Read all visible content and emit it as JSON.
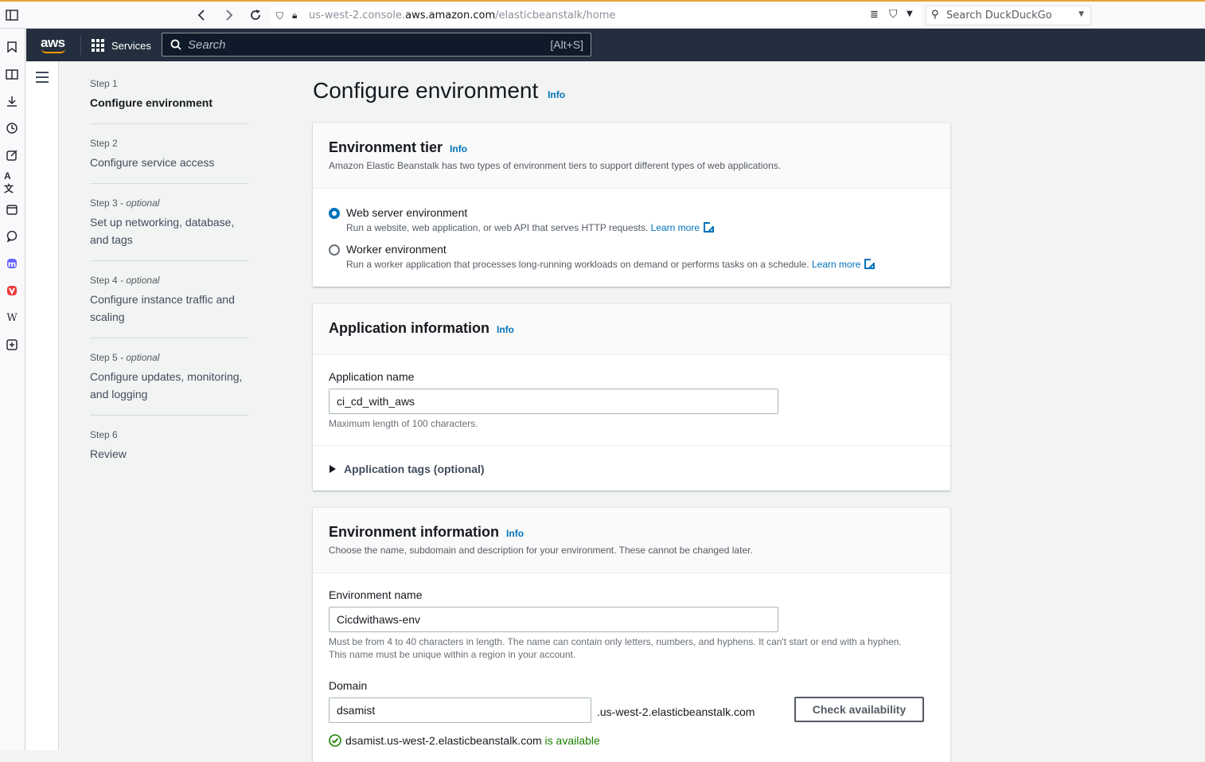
{
  "browser": {
    "url_prefix": "us-west-2.console.",
    "url_host": "aws.amazon.com",
    "url_path": "/elasticbeanstalk/home",
    "search_placeholder": "Search DuckDuckGo"
  },
  "aws_header": {
    "logo": "aws",
    "services_label": "Services",
    "search_placeholder": "Search",
    "search_shortcut": "[Alt+S]"
  },
  "steps": [
    {
      "num": "Step 1",
      "optional": "",
      "title": "Configure environment"
    },
    {
      "num": "Step 2",
      "optional": "",
      "title": "Configure service access"
    },
    {
      "num": "Step 3",
      "optional": " - optional",
      "title": "Set up networking, database, and tags"
    },
    {
      "num": "Step 4",
      "optional": " - optional",
      "title": "Configure instance traffic and scaling"
    },
    {
      "num": "Step 5",
      "optional": " - optional",
      "title": "Configure updates, monitoring, and logging"
    },
    {
      "num": "Step 6",
      "optional": "",
      "title": "Review"
    }
  ],
  "page": {
    "title": "Configure environment",
    "info": "Info"
  },
  "env_tier": {
    "title": "Environment tier",
    "info": "Info",
    "description": "Amazon Elastic Beanstalk has two types of environment tiers to support different types of web applications.",
    "options": [
      {
        "title": "Web server environment",
        "description": "Run a website, web application, or web API that serves HTTP requests.",
        "link": "Learn more",
        "selected": true
      },
      {
        "title": "Worker environment",
        "description": "Run a worker application that processes long-running workloads on demand or performs tasks on a schedule.",
        "link": "Learn more",
        "selected": false
      }
    ]
  },
  "app_info": {
    "title": "Application information",
    "info": "Info",
    "name_label": "Application name",
    "name_value": "ci_cd_with_aws",
    "name_hint": "Maximum length of 100 characters.",
    "tags_label": "Application tags (optional)"
  },
  "env_info": {
    "title": "Environment information",
    "info": "Info",
    "description": "Choose the name, subdomain and description for your environment. These cannot be changed later.",
    "name_label": "Environment name",
    "name_value": "Cicdwithaws-env",
    "name_hint_1": "Must be from 4 to 40 characters in length. The name can contain only letters, numbers, and hyphens. It can't start or end with a hyphen.",
    "name_hint_2": "This name must be unique within a region in your account.",
    "domain_label": "Domain",
    "domain_value": "dsamist",
    "domain_suffix": ".us-west-2.elasticbeanstalk.com",
    "check_button": "Check availability",
    "availability_domain": "dsamist.us-west-2.elasticbeanstalk.com",
    "availability_status": "is available",
    "status_color": "#1d8102"
  }
}
